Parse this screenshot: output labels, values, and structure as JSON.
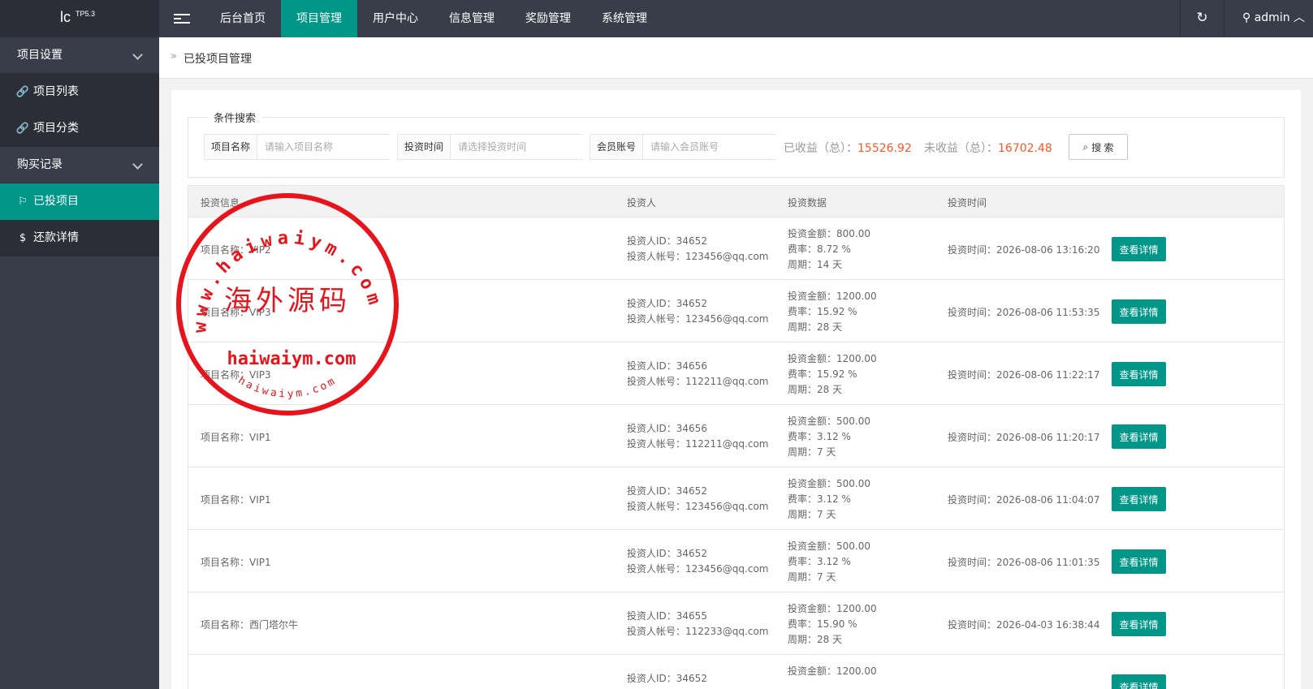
{
  "header": {
    "logo": "lc",
    "version": "TP5.3",
    "nav": [
      "后台首页",
      "项目管理",
      "用户中心",
      "信息管理",
      "奖励管理",
      "系统管理"
    ],
    "active_nav": "项目管理",
    "user": "admin"
  },
  "sidebar": {
    "groups": [
      {
        "label": "项目设置",
        "items": [
          {
            "label": "项目列表",
            "icon": "link-icon"
          },
          {
            "label": "项目分类",
            "icon": "link-icon"
          }
        ]
      },
      {
        "label": "购买记录",
        "items": [
          {
            "label": "已投项目",
            "icon": "flag-icon"
          },
          {
            "label": "还款详情",
            "icon": "dollar-icon"
          }
        ]
      }
    ],
    "active_item": "已投项目"
  },
  "breadcrumb": "已投项目管理",
  "search": {
    "legend": "条件搜索",
    "project_name_label": "项目名称",
    "project_name_placeholder": "请输入项目名称",
    "time_label": "投资时间",
    "time_placeholder": "请选择投资时间",
    "member_label": "会员账号",
    "member_placeholder": "请输入会员账号",
    "earned_label": "已收益（总）：",
    "earned_value": "15526.92",
    "unearned_label": "未收益（总）：",
    "unearned_value": "16702.48",
    "button": "搜 索"
  },
  "table": {
    "headers": [
      "投资信息",
      "投资人",
      "投资数据",
      "投资时间"
    ],
    "detail_button": "查看详情",
    "rows": [
      {
        "project": "项目名称：VIP2",
        "investor_id": "投资人ID：34652",
        "investor_account": "投资人帐号：123456@qq.com",
        "amount": "投资金额：800.00",
        "rate": "费率：8.72 %",
        "period": "周期：14 天",
        "time": "投资时间：2026-08-06 13:16:20"
      },
      {
        "project": "项目名称：VIP3",
        "investor_id": "投资人ID：34652",
        "investor_account": "投资人帐号：123456@qq.com",
        "amount": "投资金额：1200.00",
        "rate": "费率：15.92 %",
        "period": "周期：28 天",
        "time": "投资时间：2026-08-06 11:53:35"
      },
      {
        "project": "项目名称：VIP3",
        "investor_id": "投资人ID：34656",
        "investor_account": "投资人帐号：112211@qq.com",
        "amount": "投资金额：1200.00",
        "rate": "费率：15.92 %",
        "period": "周期：28 天",
        "time": "投资时间：2026-08-06 11:22:17"
      },
      {
        "project": "项目名称：VIP1",
        "investor_id": "投资人ID：34656",
        "investor_account": "投资人帐号：112211@qq.com",
        "amount": "投资金额：500.00",
        "rate": "费率：3.12 %",
        "period": "周期：7 天",
        "time": "投资时间：2026-08-06 11:20:17"
      },
      {
        "project": "项目名称：VIP1",
        "investor_id": "投资人ID：34652",
        "investor_account": "投资人帐号：123456@qq.com",
        "amount": "投资金额：500.00",
        "rate": "费率：3.12 %",
        "period": "周期：7 天",
        "time": "投资时间：2026-08-06 11:04:07"
      },
      {
        "project": "项目名称：VIP1",
        "investor_id": "投资人ID：34652",
        "investor_account": "投资人帐号：123456@qq.com",
        "amount": "投资金额：500.00",
        "rate": "费率：3.12 %",
        "period": "周期：7 天",
        "time": "投资时间：2026-08-06 11:01:35"
      },
      {
        "project": "项目名称：西门塔尔牛",
        "investor_id": "投资人ID：34655",
        "investor_account": "投资人帐号：112233@qq.com",
        "amount": "投资金额：1200.00",
        "rate": "费率：15.90 %",
        "period": "周期：28 天",
        "time": "投资时间：2026-04-03 16:38:44"
      },
      {
        "project": "",
        "investor_id": "投资人ID：34652",
        "investor_account": "",
        "amount": "投资金额：1200.00",
        "rate": "",
        "period": "",
        "time": ""
      }
    ]
  },
  "watermark": {
    "top_arc": "www.haiwaiym.com",
    "center": "海外源码",
    "domain": "haiwaiym.com",
    "bottom_arc": "haiwaiym.com",
    "color": "#e8141c"
  },
  "colors": {
    "accent": "#009688",
    "header": "#393d49",
    "highlight": "#ff5722"
  }
}
